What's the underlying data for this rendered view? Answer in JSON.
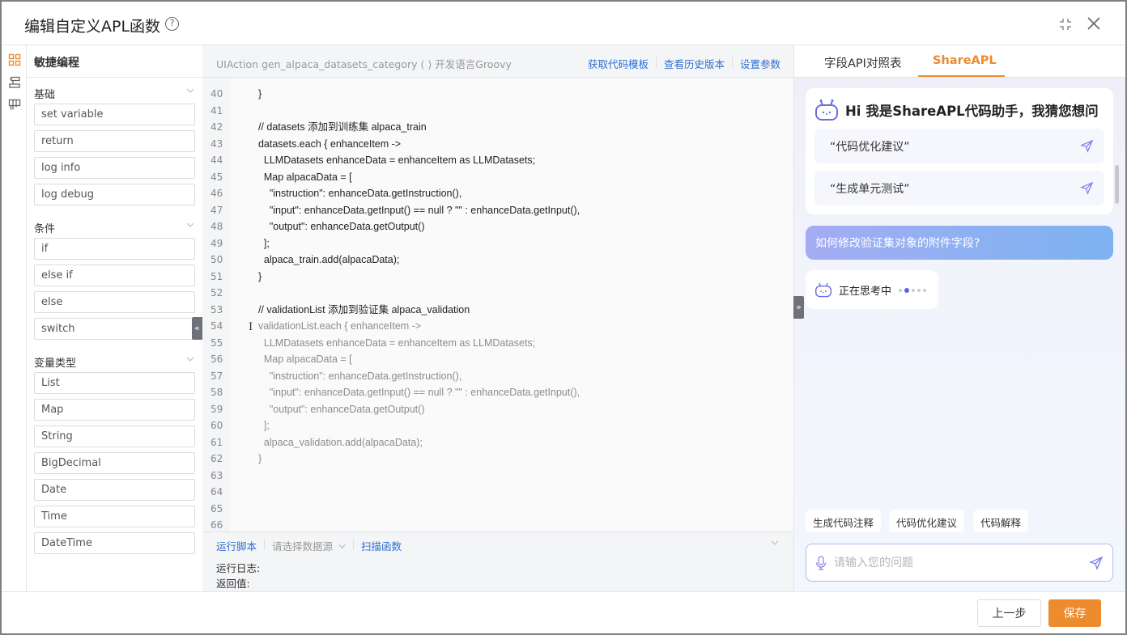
{
  "window": {
    "title": "编辑自定义APL函数",
    "help_icon": "?"
  },
  "rail": {
    "icons": [
      "grid-icon",
      "tree-icon",
      "board-icon"
    ],
    "active": "grid-icon",
    "accent_color": "#ed8b2f"
  },
  "snippets": {
    "title": "敏捷编程",
    "groups": [
      {
        "title": "基础",
        "items": [
          "set variable",
          "return",
          "log info",
          "log debug"
        ]
      },
      {
        "title": "条件",
        "items": [
          "if",
          "else if",
          "else",
          "switch"
        ]
      },
      {
        "title": "变量类型",
        "items": [
          "List",
          "Map",
          "String",
          "BigDecimal",
          "Date",
          "Time",
          "DateTime"
        ]
      }
    ],
    "collapse_label": "«"
  },
  "editor": {
    "signature": "UIAction gen_alpaca_datasets_category ( ) 开发语言Groovy",
    "links": [
      "获取代码模板",
      "查看历史版本",
      "设置参数"
    ],
    "link_color": "#2f6fd1",
    "active_line": 54,
    "lines": [
      {
        "n": "40",
        "code": "  }",
        "dim": false
      },
      {
        "n": "41",
        "code": "",
        "dim": false
      },
      {
        "n": "42",
        "code": "  // datasets 添加到训练集 alpaca_train",
        "dim": false
      },
      {
        "n": "43",
        "code": "  datasets.each { enhanceItem ->",
        "dim": false
      },
      {
        "n": "44",
        "code": "    LLMDatasets enhanceData = enhanceItem as LLMDatasets;",
        "dim": false
      },
      {
        "n": "45",
        "code": "    Map alpacaData = [",
        "dim": false
      },
      {
        "n": "46",
        "code": "      \"instruction\": enhanceData.getInstruction(),",
        "dim": false
      },
      {
        "n": "47",
        "code": "      \"input\": enhanceData.getInput() == null ? \"\" : enhanceData.getInput(),",
        "dim": false
      },
      {
        "n": "48",
        "code": "      \"output\": enhanceData.getOutput()",
        "dim": false
      },
      {
        "n": "49",
        "code": "    ];",
        "dim": false
      },
      {
        "n": "50",
        "code": "    alpaca_train.add(alpacaData);",
        "dim": false
      },
      {
        "n": "51",
        "code": "  }",
        "dim": false
      },
      {
        "n": "52",
        "code": "",
        "dim": false
      },
      {
        "n": "53",
        "code": "  // validationList 添加到验证集 alpaca_validation",
        "dim": false
      },
      {
        "n": "54",
        "code": "  validationList.each { enhanceItem ->",
        "dim": true
      },
      {
        "n": "55",
        "code": "    LLMDatasets enhanceData = enhanceItem as LLMDatasets;",
        "dim": true
      },
      {
        "n": "56",
        "code": "    Map alpacaData = [",
        "dim": true
      },
      {
        "n": "57",
        "code": "      \"instruction\": enhanceData.getInstruction(),",
        "dim": true
      },
      {
        "n": "58",
        "code": "      \"input\": enhanceData.getInput() == null ? \"\" : enhanceData.getInput(),",
        "dim": true
      },
      {
        "n": "59",
        "code": "      \"output\": enhanceData.getOutput()",
        "dim": true
      },
      {
        "n": "60",
        "code": "    ];",
        "dim": true
      },
      {
        "n": "61",
        "code": "    alpaca_validation.add(alpacaData);",
        "dim": true
      },
      {
        "n": "62",
        "code": "  }",
        "dim": true
      },
      {
        "n": "63",
        "code": "",
        "dim": false
      },
      {
        "n": "64",
        "code": "",
        "dim": false
      },
      {
        "n": "65",
        "code": "",
        "dim": false
      },
      {
        "n": "66",
        "code": "",
        "dim": false
      }
    ],
    "run": {
      "run_label": "运行脚本",
      "datasource_placeholder": "请选择数据源",
      "scan_label": "扫描函数",
      "log_label": "运行日志:",
      "return_label": "返回值:"
    },
    "collapse_label": "»"
  },
  "assistant": {
    "tabs": [
      {
        "label": "字段API对照表",
        "active": false
      },
      {
        "label": "ShareAPL",
        "active": true
      }
    ],
    "welcome_title": "Hi 我是ShareAPL代码助手，我猜您想问",
    "suggestions": [
      "“代码优化建议”",
      "“生成单元测试”"
    ],
    "user_message": "如何修改验证集对象的附件字段?",
    "thinking_text": "正在思考中",
    "quick_actions": [
      "生成代码注释",
      "代码优化建议",
      "代码解释"
    ],
    "input_placeholder": "请输入您的问题",
    "input_value": ""
  },
  "footer": {
    "prev_label": "上一步",
    "save_label": "保存",
    "save_color": "#ed8b2f"
  }
}
